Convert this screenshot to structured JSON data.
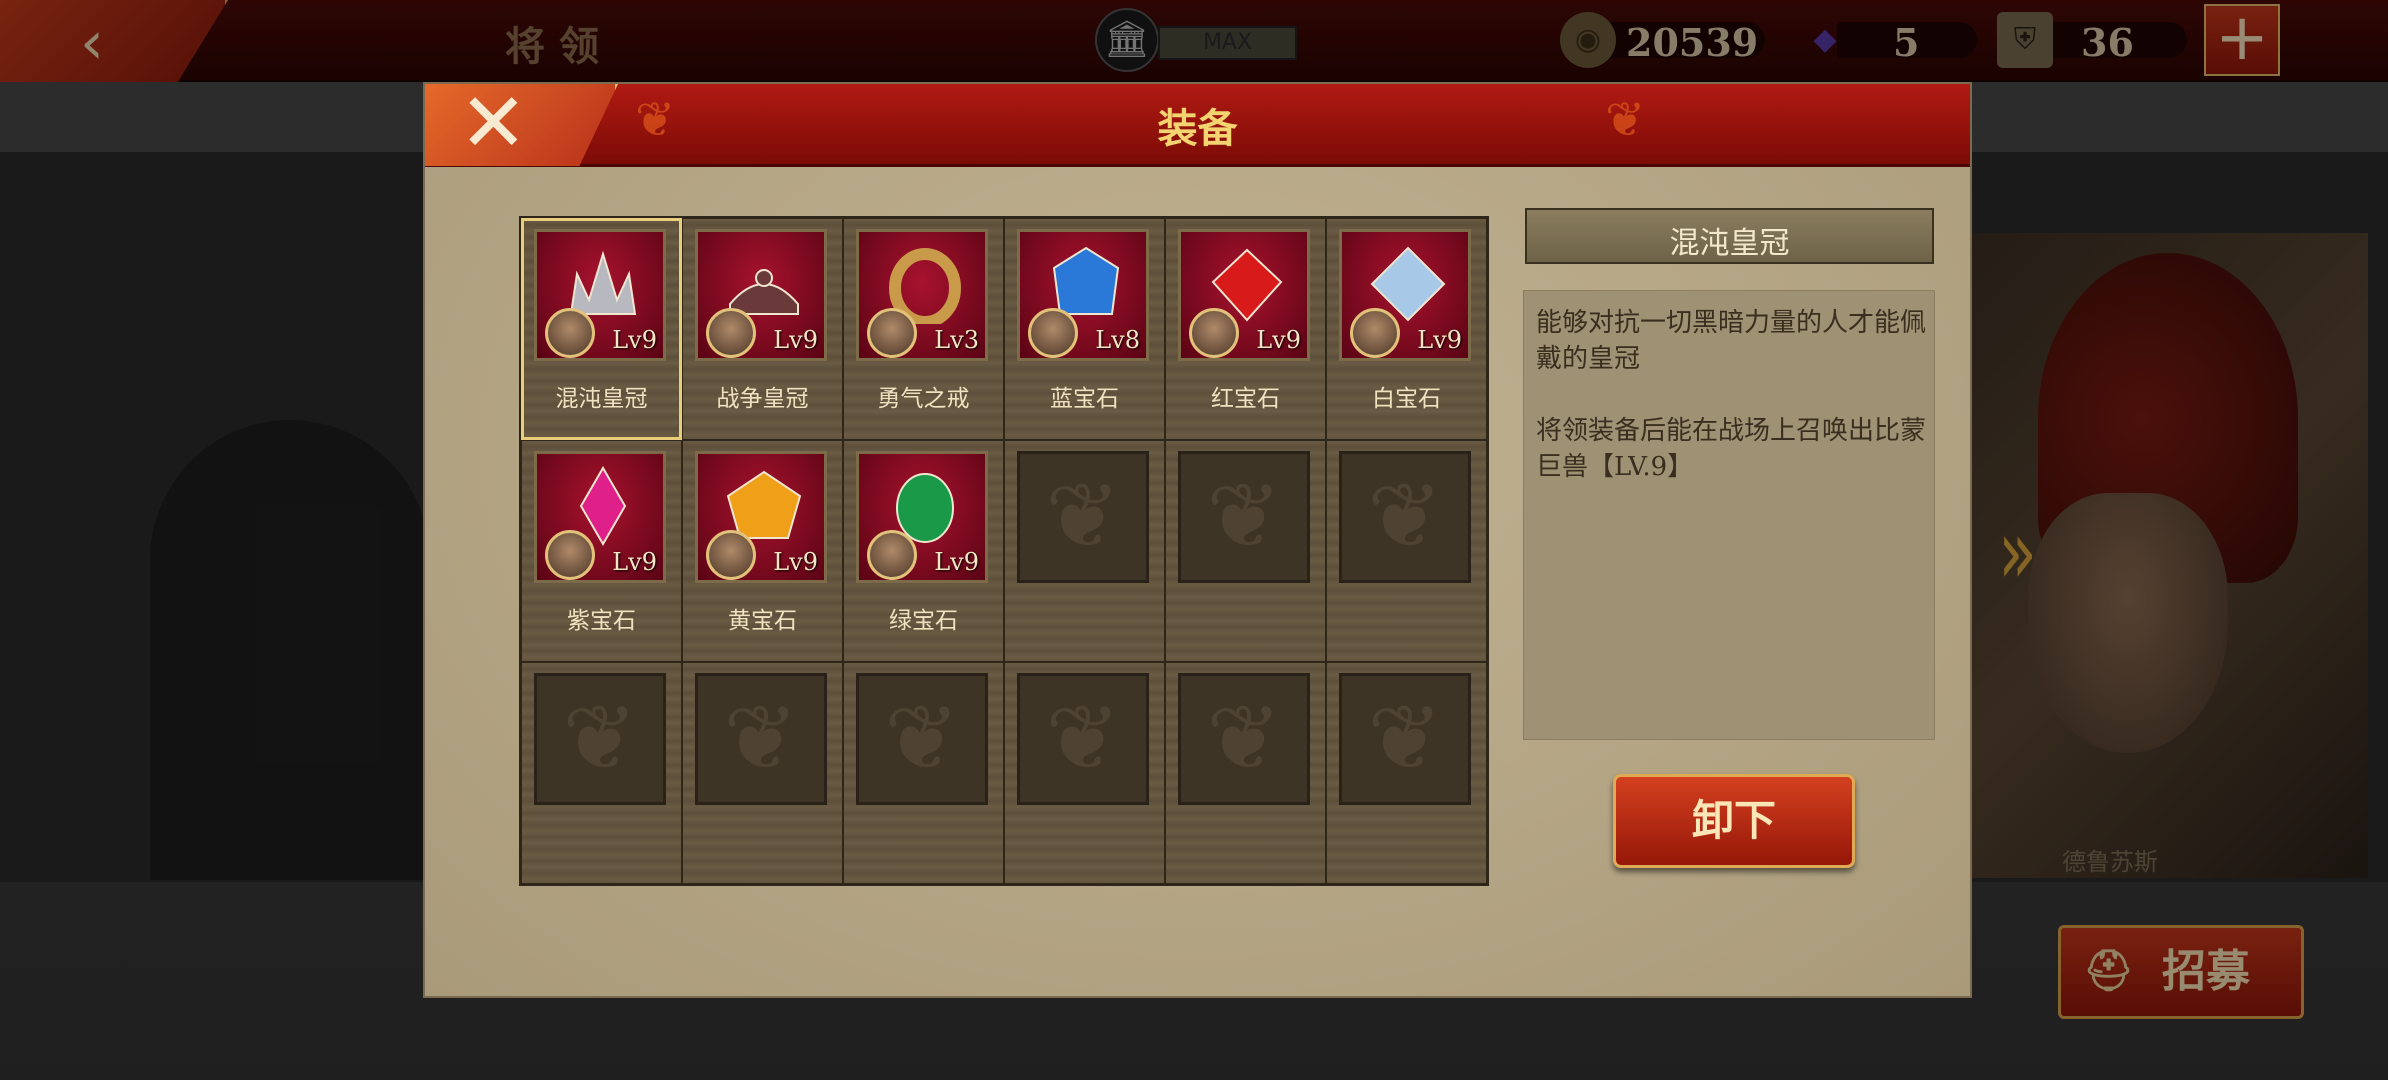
{
  "topbar": {
    "title": "将领",
    "max_label": "MAX",
    "coins": "20539",
    "gems": "5",
    "tickets": "36",
    "plus_label": "+"
  },
  "background": {
    "hero_name": "德鲁苏斯",
    "recruit_label": "招募"
  },
  "dialog": {
    "title": "装备",
    "items": [
      {
        "name": "混沌皇冠",
        "level": "Lv9",
        "icon": "chaos-crown-icon",
        "color": "#b8b8c0",
        "selected": true
      },
      {
        "name": "战争皇冠",
        "level": "Lv9",
        "icon": "war-crown-icon",
        "color": "#6a3a3a"
      },
      {
        "name": "勇气之戒",
        "level": "Lv3",
        "icon": "ring-of-courage-icon",
        "color": "#c89a4a"
      },
      {
        "name": "蓝宝石",
        "level": "Lv8",
        "icon": "sapphire-icon",
        "color": "#2a78d8"
      },
      {
        "name": "红宝石",
        "level": "Lv9",
        "icon": "ruby-icon",
        "color": "#d81a1a"
      },
      {
        "name": "白宝石",
        "level": "Lv9",
        "icon": "white-gem-icon",
        "color": "#a8c8e8"
      },
      {
        "name": "紫宝石",
        "level": "Lv9",
        "icon": "amethyst-icon",
        "color": "#e0208a"
      },
      {
        "name": "黄宝石",
        "level": "Lv9",
        "icon": "topaz-icon",
        "color": "#f0a018"
      },
      {
        "name": "绿宝石",
        "level": "Lv9",
        "icon": "emerald-icon",
        "color": "#1a9a48"
      }
    ],
    "detail": {
      "title": "混沌皇冠",
      "description": "能够对抗一切黑暗力量的人才能佩戴的皇冠\n\n将领装备后能在战场上召唤出比蒙巨兽【LV.9】",
      "unequip_label": "卸下"
    }
  }
}
